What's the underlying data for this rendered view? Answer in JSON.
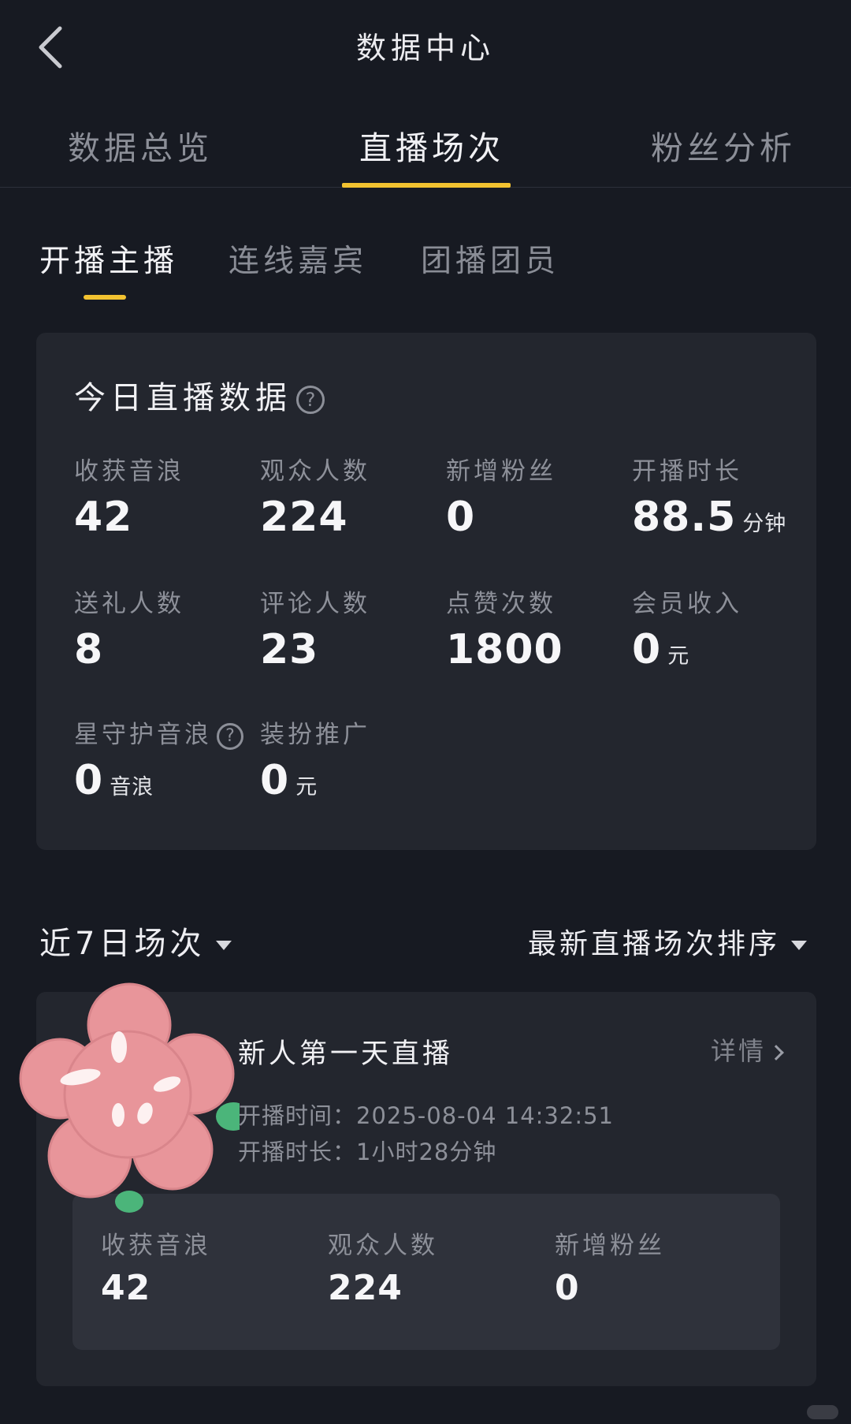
{
  "header": {
    "title": "数据中心",
    "back_icon": "chevron-left-icon"
  },
  "tabs": [
    {
      "label": "数据总览",
      "active": false
    },
    {
      "label": "直播场次",
      "active": true
    },
    {
      "label": "粉丝分析",
      "active": false
    }
  ],
  "subtabs": [
    {
      "label": "开播主播",
      "active": true
    },
    {
      "label": "连线嘉宾",
      "active": false
    },
    {
      "label": "团播团员",
      "active": false
    }
  ],
  "today": {
    "title": "今日直播数据",
    "stats": [
      {
        "label": "收获音浪",
        "value": "42",
        "unit": ""
      },
      {
        "label": "观众人数",
        "value": "224",
        "unit": ""
      },
      {
        "label": "新增粉丝",
        "value": "0",
        "unit": ""
      },
      {
        "label": "开播时长",
        "value": "88.5",
        "unit": "分钟"
      },
      {
        "label": "送礼人数",
        "value": "8",
        "unit": ""
      },
      {
        "label": "评论人数",
        "value": "23",
        "unit": ""
      },
      {
        "label": "点赞次数",
        "value": "1800",
        "unit": ""
      },
      {
        "label": "会员收入",
        "value": "0",
        "unit": "元"
      },
      {
        "label": "星守护音浪",
        "value": "0",
        "unit": "音浪"
      },
      {
        "label": "装扮推广",
        "value": "0",
        "unit": "元"
      }
    ]
  },
  "filters": {
    "range": "近7日场次",
    "sort": "最新直播场次排序"
  },
  "session": {
    "title": "新人第一天直播",
    "detail": "详情",
    "start_time": "开播时间：2025-08-04 14:32:51",
    "duration": "开播时长：1小时28分钟",
    "stats": [
      {
        "label": "收获音浪",
        "value": "42"
      },
      {
        "label": "观众人数",
        "value": "224"
      },
      {
        "label": "新增粉丝",
        "value": "0"
      }
    ]
  },
  "colors": {
    "background": "#171a22",
    "card": "#23262e",
    "accent": "#f2c230",
    "sticker_pink": "#e8959a",
    "sticker_green": "#4bb57a"
  }
}
